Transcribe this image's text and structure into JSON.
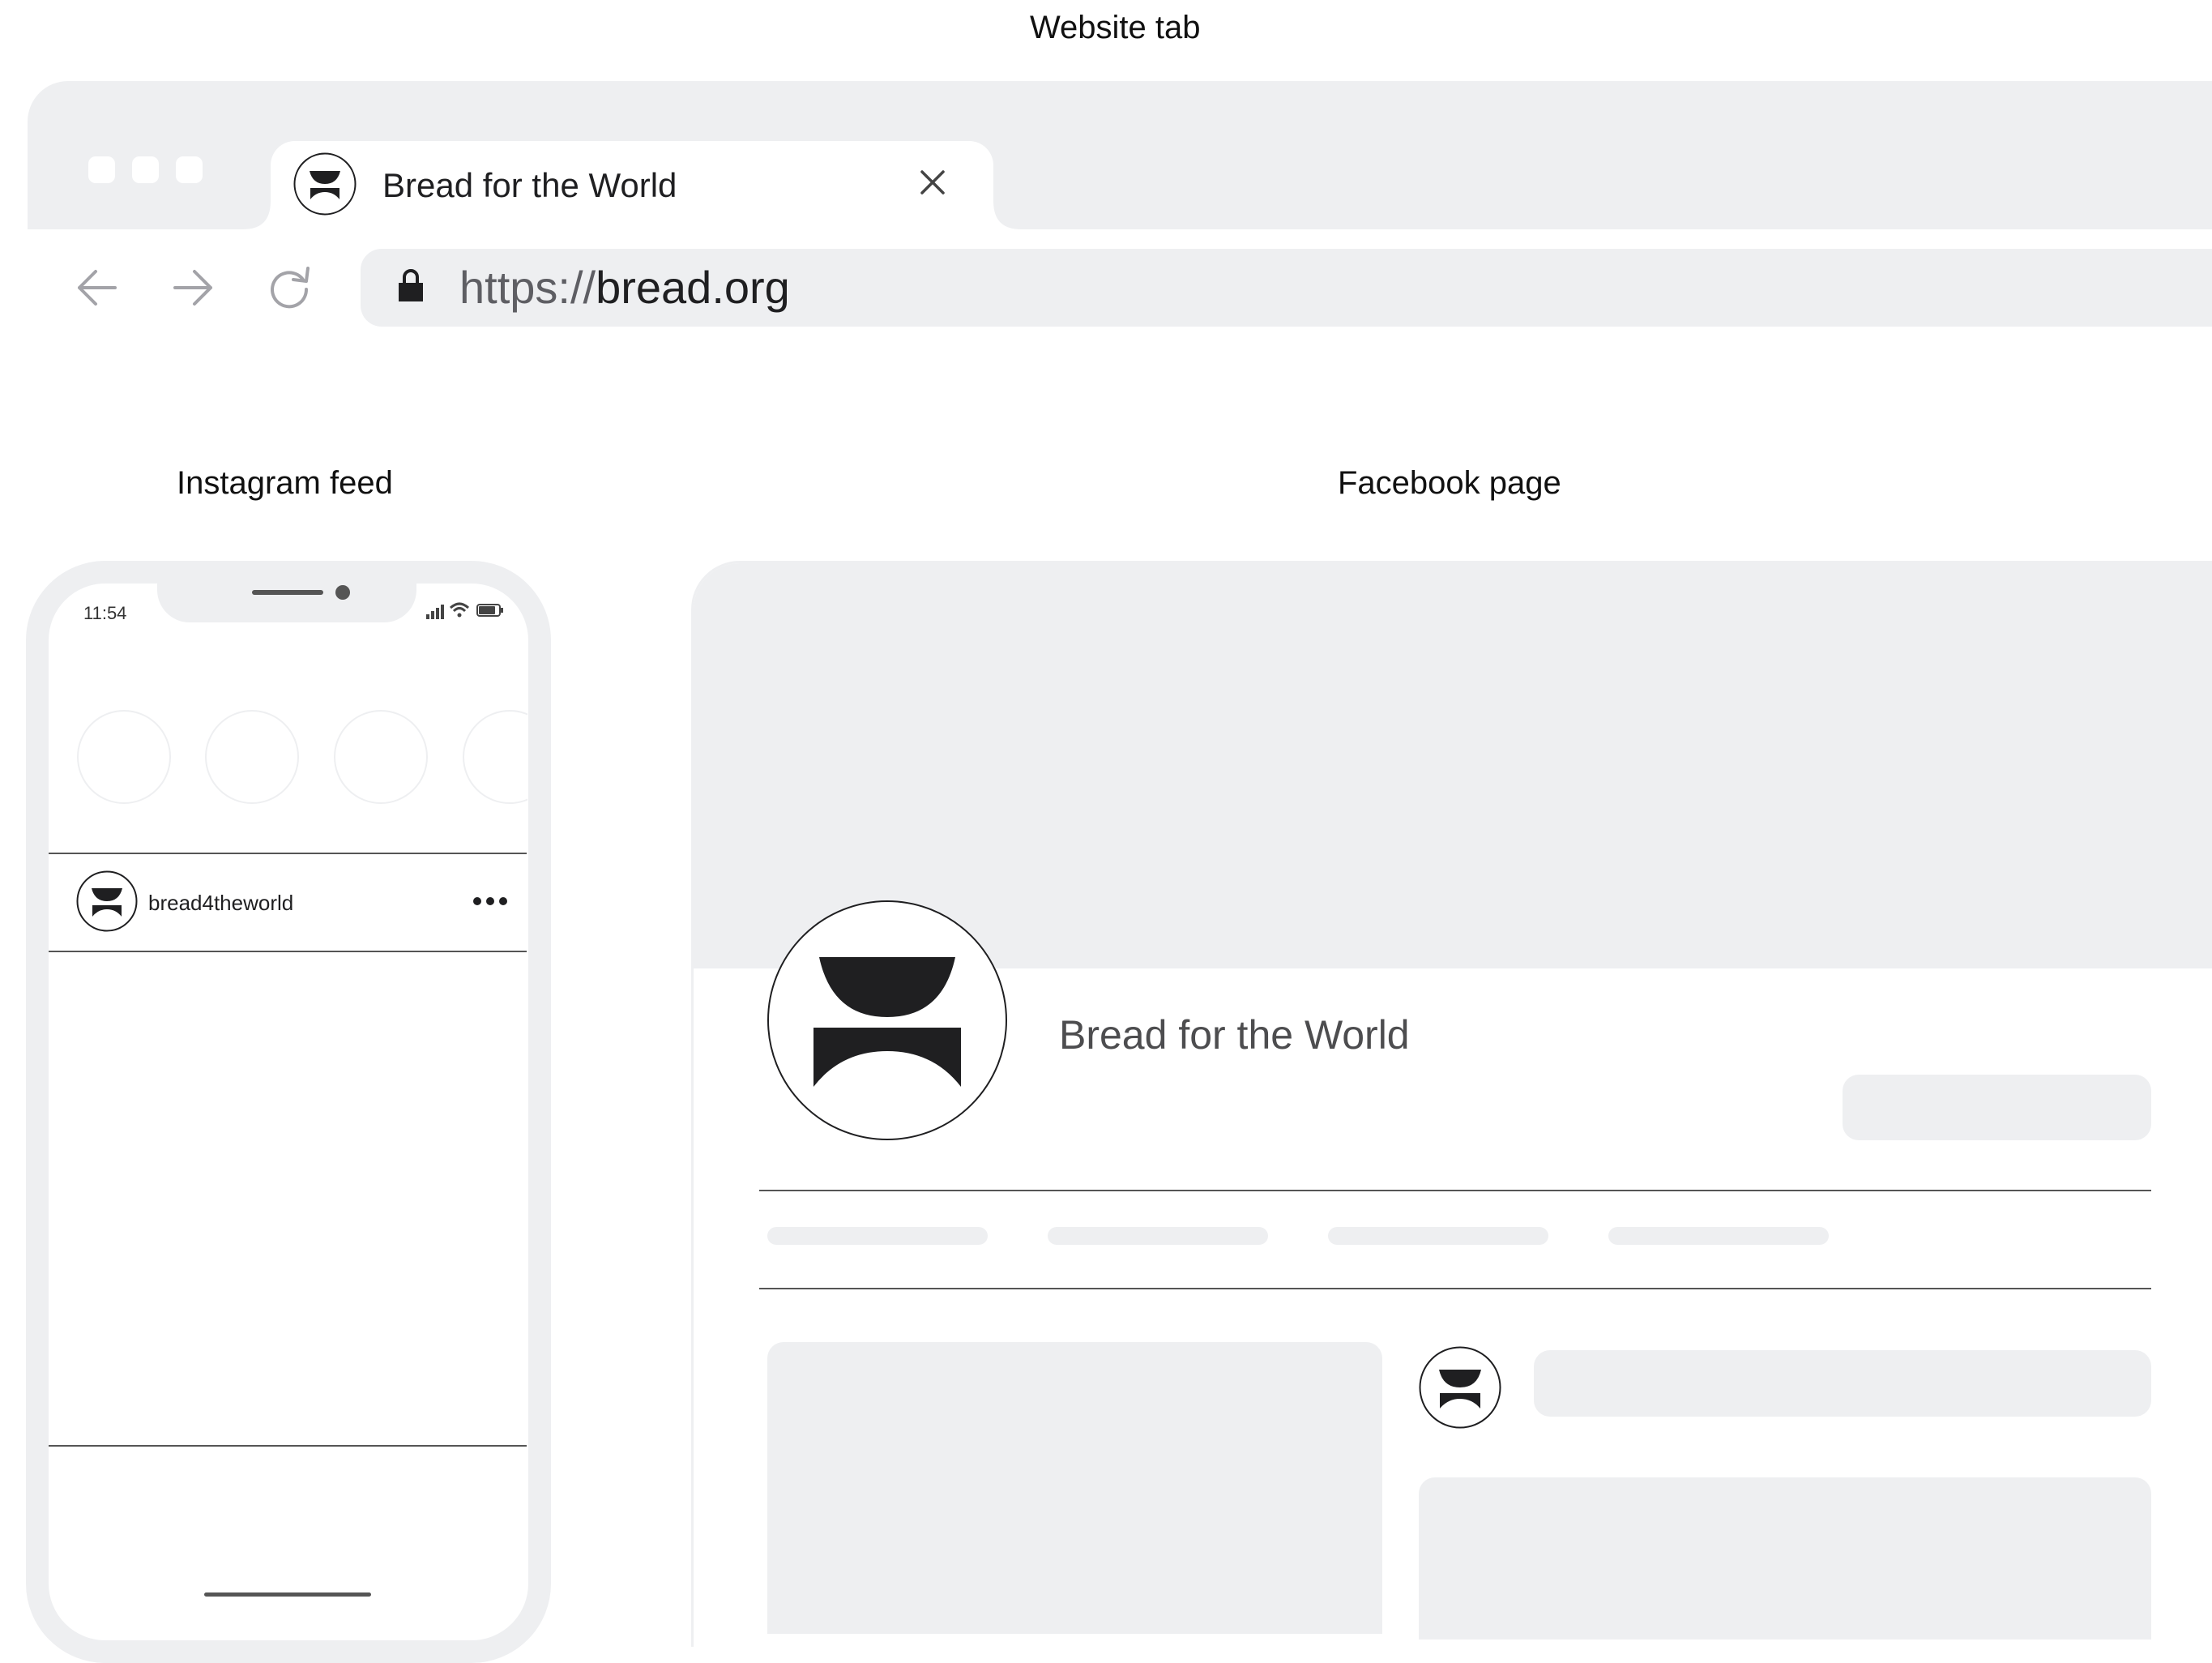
{
  "captions": {
    "website": "Website tab",
    "instagram": "Instagram feed",
    "facebook": "Facebook page"
  },
  "browser": {
    "tab_title": "Bread for the World",
    "url_scheme": "https://",
    "url_host": "bread.org",
    "icons": [
      "arrow-back-icon",
      "arrow-forward-icon",
      "reload-icon",
      "lock-icon",
      "close-icon"
    ]
  },
  "instagram": {
    "status_time": "11:54",
    "username": "bread4theworld",
    "icons": [
      "signal-icon",
      "wifi-icon",
      "battery-icon",
      "more-icon"
    ]
  },
  "facebook": {
    "page_name": "Bread for the World"
  },
  "colors": {
    "placeholder_gray": "#eeeff1",
    "logo_dark": "#1f1f21"
  }
}
